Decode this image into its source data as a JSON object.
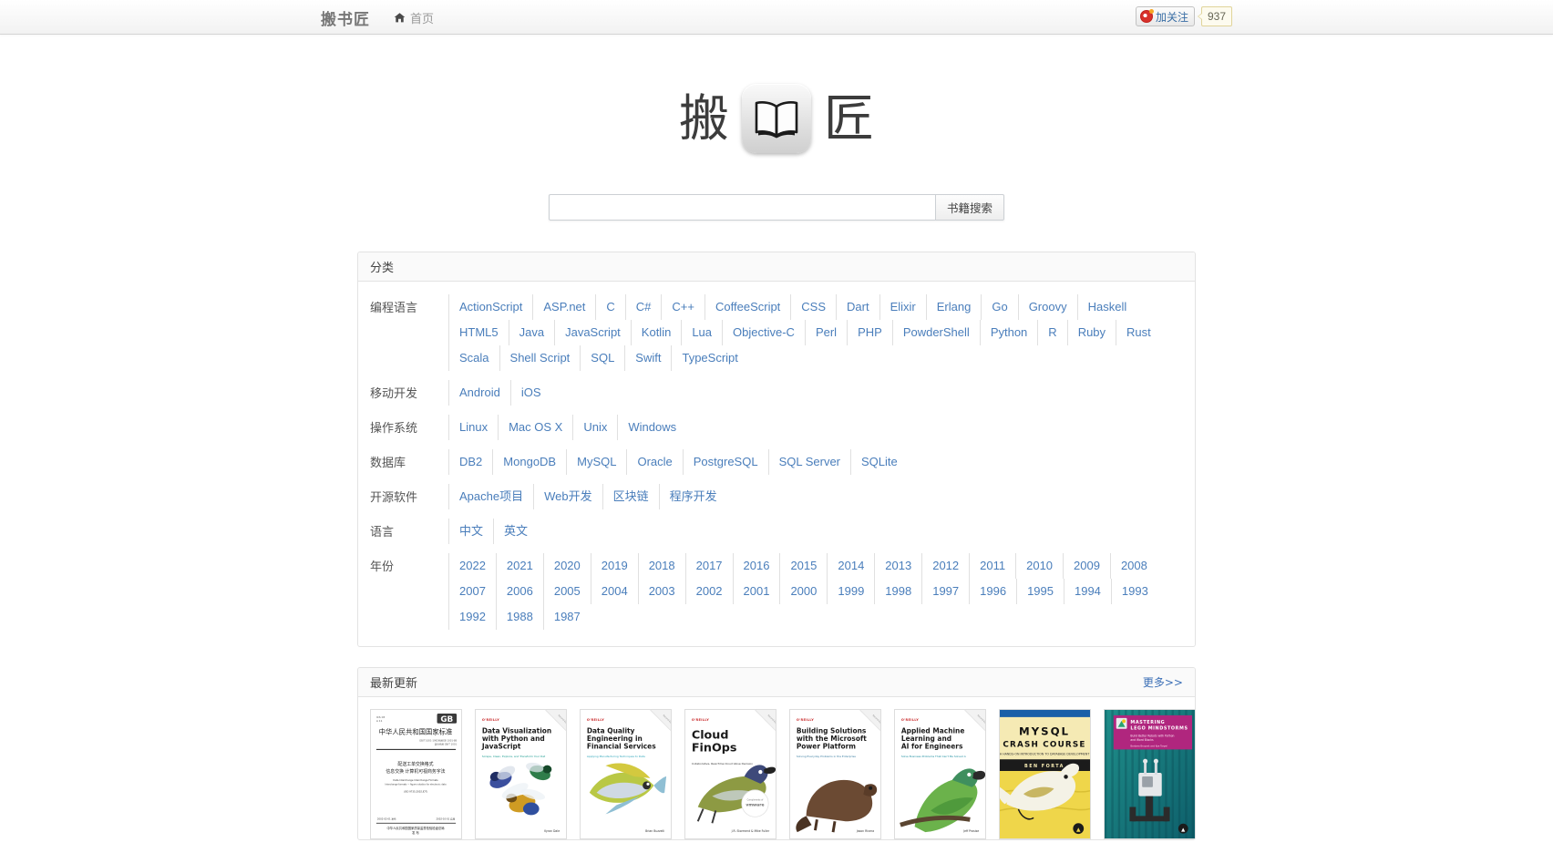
{
  "navbar": {
    "brand": "搬书匠",
    "home_label": "首页",
    "home_icon": "home-icon",
    "weibo_label": "加关注",
    "weibo_icon": "weibo-logo-icon",
    "weibo_count": "937"
  },
  "logo": {
    "left_char": "搬",
    "right_char": "匠",
    "book_icon": "open-book-icon"
  },
  "search": {
    "value": "",
    "placeholder": "",
    "button_label": "书籍搜索"
  },
  "categories_panel": {
    "title": "分类",
    "rows": [
      {
        "label": "编程语言",
        "items": [
          "ActionScript",
          "ASP.net",
          "C",
          "C#",
          "C++",
          "CoffeeScript",
          "CSS",
          "Dart",
          "Elixir",
          "Erlang",
          "Go",
          "Groovy",
          "Haskell",
          "HTML5",
          "Java",
          "JavaScript",
          "Kotlin",
          "Lua",
          "Objective-C",
          "Perl",
          "PHP",
          "PowderShell",
          "Python",
          "R",
          "Ruby",
          "Rust",
          "Scala",
          "Shell Script",
          "SQL",
          "Swift",
          "TypeScript"
        ]
      },
      {
        "label": "移动开发",
        "items": [
          "Android",
          "iOS"
        ]
      },
      {
        "label": "操作系统",
        "items": [
          "Linux",
          "Mac OS X",
          "Unix",
          "Windows"
        ]
      },
      {
        "label": "数据库",
        "items": [
          "DB2",
          "MongoDB",
          "MySQL",
          "Oracle",
          "PostgreSQL",
          "SQL Server",
          "SQLite"
        ]
      },
      {
        "label": "开源软件",
        "items": [
          "Apache项目",
          "Web开发",
          "区块链",
          "程序开发"
        ]
      },
      {
        "label": "语言",
        "items": [
          "中文",
          "英文"
        ]
      },
      {
        "label": "年份",
        "items": [
          "2022",
          "2021",
          "2020",
          "2019",
          "2018",
          "2017",
          "2016",
          "2015",
          "2014",
          "2013",
          "2012",
          "2011",
          "2010",
          "2009",
          "2008",
          "2007",
          "2006",
          "2005",
          "2004",
          "2003",
          "2002",
          "2001",
          "2000",
          "1999",
          "1998",
          "1997",
          "1996",
          "1995",
          "1994",
          "1993",
          "1992",
          "1988",
          "1987"
        ]
      }
    ]
  },
  "latest_panel": {
    "title": "最新更新",
    "more_label": "更多>>",
    "books": [
      {
        "kind": "gb-standard",
        "publisher": "GB",
        "header": "中华人民共和国国家标准",
        "title_lines": [
          "配送工单交换格式",
          "信息交换  计算机可视商务字法"
        ],
        "subtitle": "Data Interchange  Interchange Formats",
        "author": ""
      },
      {
        "kind": "oreilly-light",
        "publisher": "O'REILLY",
        "title_lines": [
          "Data Visualization",
          "with Python and",
          "JavaScript"
        ],
        "subtitle": "Scrape, Clean, Explore, and Transform Your Data",
        "author": "Kyran Dale",
        "animal": "bees",
        "accent": "#1a9b8f"
      },
      {
        "kind": "oreilly-light",
        "publisher": "O'REILLY",
        "title_lines": [
          "Data Quality",
          "Engineering in",
          "Financial Services"
        ],
        "subtitle": "Applying Manufacturing Techniques to Data",
        "author": "Brian Buzzelli",
        "animal": "fish",
        "accent": "#2aa3b8"
      },
      {
        "kind": "oreilly-light",
        "publisher": "O'REILLY",
        "title_lines": [
          "Cloud",
          "FinOps"
        ],
        "subtitle": "Collaborative, Real-Time Cloud Value Decision Making",
        "author": "J.R. Storment & Mike Fuller",
        "animal": "bird",
        "badge": "vmware",
        "accent": "#333333"
      },
      {
        "kind": "oreilly-light",
        "publisher": "O'REILLY",
        "title_lines": [
          "Building Solutions",
          "with the Microsoft",
          "Power Platform"
        ],
        "subtitle": "Solving Everyday Problems in the Enterprise",
        "author": "Jason Rivera",
        "animal": "beaver",
        "accent": "#3b7ea1"
      },
      {
        "kind": "oreilly-light",
        "publisher": "O'REILLY",
        "title_lines": [
          "Applied Machine",
          "Learning and",
          "AI for Engineers"
        ],
        "subtitle": "Solve Business Problems That Can't Be Solved Algorithmically",
        "author": "Jeff Prosise",
        "animal": "parrot",
        "accent": "#1f8fa0"
      },
      {
        "kind": "nostarch-yellow",
        "title_lines": [
          "MYSQL",
          "CRASH COURSE"
        ],
        "subtitle": "A HANDS-ON INTRODUCTION TO DATABASE DEVELOPMENT",
        "author": "BEN FORTA",
        "animal": "dolphin",
        "accent": "#1a5fa8"
      },
      {
        "kind": "nostarch-teal",
        "title_lines": [
          "MASTERING",
          "LEGO MINDSTORMS"
        ],
        "subtitle": "Build Better Robots with Python and Word Blocks",
        "author": "Barbara Bruyant and Kye Tarpel",
        "accent": "#b0267e"
      }
    ]
  }
}
